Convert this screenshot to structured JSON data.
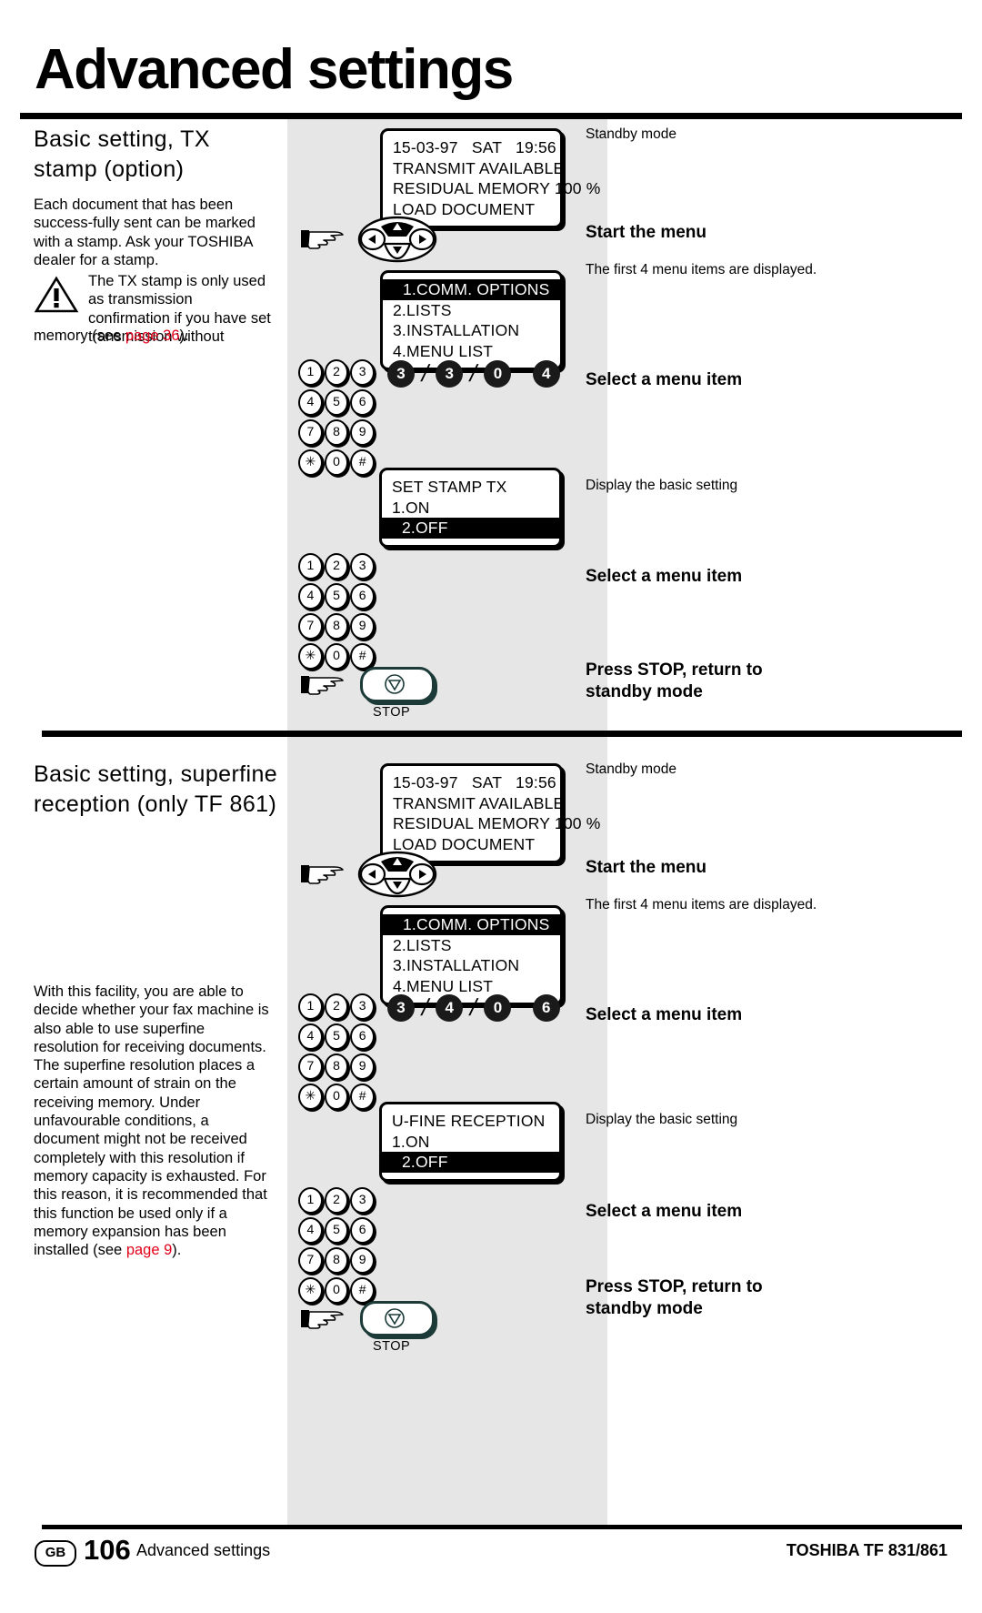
{
  "header": {
    "title": "Advanced settings"
  },
  "sections": [
    {
      "heading": "Basic setting, TX stamp (option)",
      "body": "Each document that has been success-fully sent can be marked with a stamp. Ask your TOSHIBA dealer for a stamp.",
      "note": {
        "icon": "warning-triangle-icon",
        "text": "The TX stamp is only used as transmission confirmation if you have set transmission without",
        "tail_prefix": "memory (see ",
        "tail_link": "page 36",
        "tail_suffix": ")."
      },
      "lcd_standby": {
        "line1": "15-03-97   SAT   19:56",
        "line2": "TRANSMIT AVAILABLE",
        "line3": "RESIDUAL MEMORY 100 %",
        "line4": "LOAD DOCUMENT"
      },
      "lcd_menu": {
        "line1": "1.COMM. OPTIONS",
        "line2": "2.LISTS",
        "line3": "3.INSTALLATION",
        "line4": "4.MENU LIST"
      },
      "code_digits": [
        "3",
        "3",
        "0",
        "4"
      ],
      "lcd_setting": {
        "title": "SET STAMP TX",
        "opt1": "1.ON",
        "opt2": "2.OFF"
      },
      "stop_label": "STOP",
      "annotations": {
        "standby": "Standby mode",
        "start_menu": "Start the menu",
        "start_menu_sub": "The first 4 menu items are displayed.",
        "select_item_1": "Select a menu item",
        "display_basic": "Display the basic setting",
        "select_item_2": "Select a menu item",
        "press_stop": "Press STOP, return to standby mode"
      }
    },
    {
      "heading": "Basic setting, superfine reception (only TF 861)",
      "body": "With this facility, you are able to decide whether your fax machine is also able to use superfine resolution for receiving documents. The superfine resolution places a certain amount of strain on the receiving memory. Under unfavourable conditions, a document might not be received completely with this resolution if memory capacity is exhausted. For this reason, it is recommended that this function be used only if a memory expansion has been installed (see ",
      "body_link": "page 9",
      "body_suffix": ").",
      "lcd_standby": {
        "line1": "15-03-97   SAT   19:56",
        "line2": "TRANSMIT AVAILABLE",
        "line3": "RESIDUAL MEMORY 100 %",
        "line4": "LOAD DOCUMENT"
      },
      "lcd_menu": {
        "line1": "1.COMM. OPTIONS",
        "line2": "2.LISTS",
        "line3": "3.INSTALLATION",
        "line4": "4.MENU LIST"
      },
      "code_digits": [
        "3",
        "4",
        "0",
        "6"
      ],
      "lcd_setting": {
        "title": "U-FINE RECEPTION",
        "opt1": "1.ON",
        "opt2": "2.OFF"
      },
      "stop_label": "STOP",
      "annotations": {
        "standby": "Standby mode",
        "start_menu": "Start the menu",
        "start_menu_sub": "The first 4 menu items are displayed.",
        "select_item_1": "Select a menu item",
        "display_basic": "Display the basic setting",
        "select_item_2": "Select a menu item",
        "press_stop": "Press STOP, return to standby mode"
      }
    }
  ],
  "keypad": {
    "rows": [
      [
        "1",
        "2",
        "3"
      ],
      [
        "4",
        "5",
        "6"
      ],
      [
        "7",
        "8",
        "9"
      ],
      [
        "✳",
        "0",
        "#"
      ]
    ]
  },
  "footer": {
    "region_badge": "GB",
    "page_number": "106",
    "left_text": "Advanced settings",
    "right_text": "TOSHIBA  TF 831/861"
  },
  "colors": {
    "grey_panel": "#e6e6e6",
    "link_red": "#e2001a",
    "stop_outline": "#1b3a38"
  }
}
